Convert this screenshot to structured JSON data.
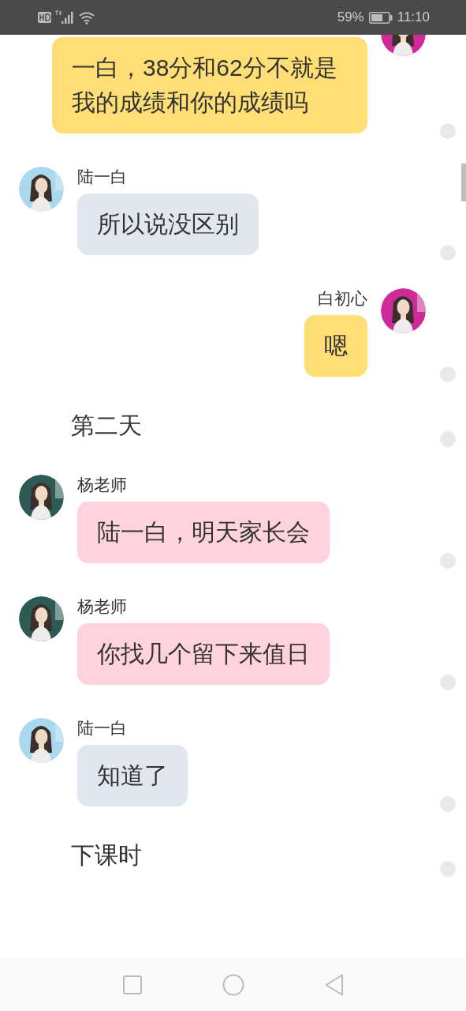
{
  "status_bar": {
    "battery": "59%",
    "time": "11:10"
  },
  "messages": [
    {
      "kind": "sent",
      "text": "一白，38分和62分不就是我的成绩和你的成绩吗",
      "color": "#ffde75",
      "selected": false
    },
    {
      "kind": "received",
      "name": "陆一白",
      "text": "所以说没区别",
      "color": "#e1e7ef",
      "selected": false
    },
    {
      "kind": "sent",
      "name": "白初心",
      "text": "嗯",
      "color": "#ffde75",
      "selected": false
    },
    {
      "kind": "narration",
      "text": "第二天",
      "selected": false
    },
    {
      "kind": "received",
      "name": "杨老师",
      "text": "陆一白，明天家长会",
      "color": "#ffd3de",
      "selected": false
    },
    {
      "kind": "received",
      "name": "杨老师",
      "text": "你找几个留下来值日",
      "color": "#ffd3de",
      "selected": false
    },
    {
      "kind": "received",
      "name": "陆一白",
      "text": "知道了",
      "color": "#e1e7ef",
      "selected": false
    },
    {
      "kind": "narration",
      "text": "下课时",
      "selected": false
    }
  ]
}
